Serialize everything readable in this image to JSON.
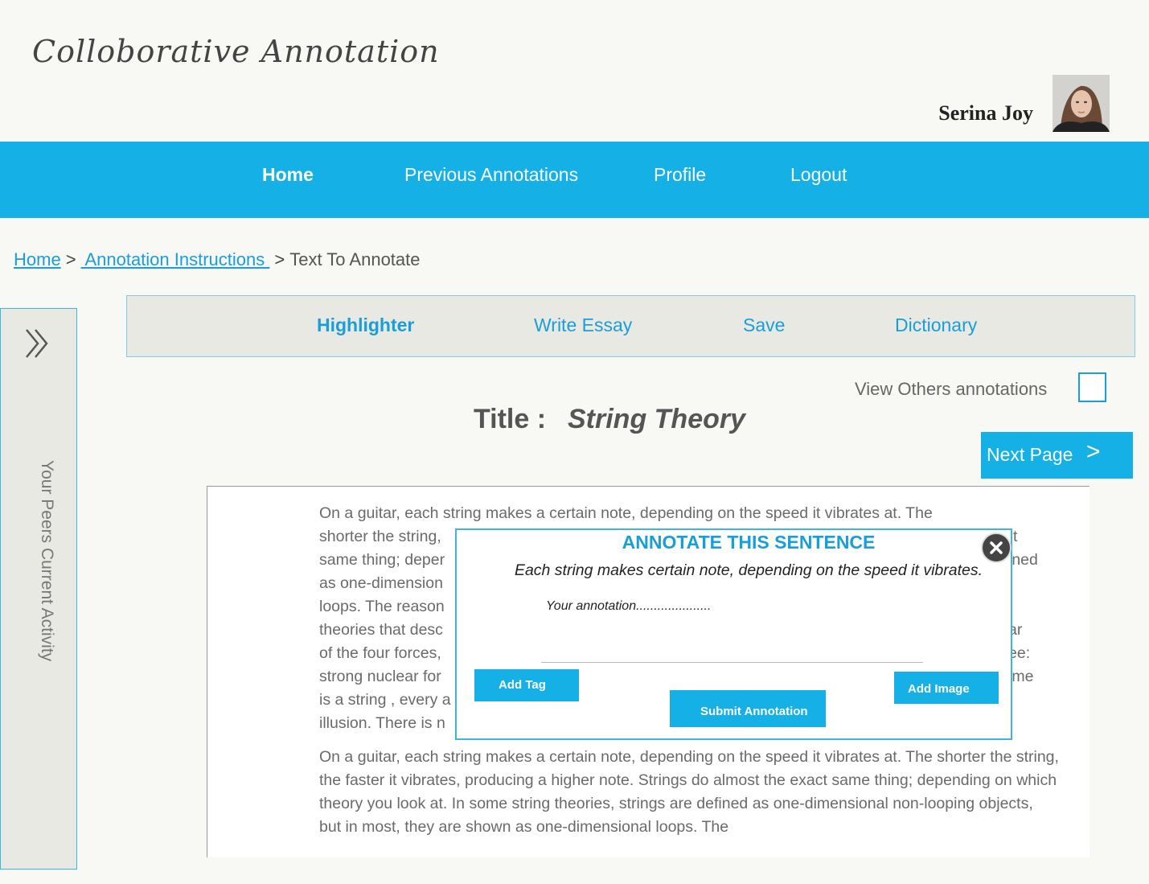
{
  "app": {
    "title": "Colloborative Annotation"
  },
  "user": {
    "name": "Serina Joy"
  },
  "nav": {
    "items": [
      {
        "label": "Home"
      },
      {
        "label": "Previous Annotations"
      },
      {
        "label": "Profile"
      },
      {
        "label": "Logout"
      }
    ],
    "active": "Home"
  },
  "breadcrumb": {
    "items": [
      {
        "label": "Home"
      },
      {
        "label": " Annotation Instructions "
      },
      {
        "label": "Text To Annotate"
      }
    ],
    "separator": ">"
  },
  "side_panel": {
    "label": "Your Peers Current Activity",
    "icon": "double-chevron-right-icon"
  },
  "toolbar": {
    "items": [
      {
        "label": "Highlighter"
      },
      {
        "label": "Write Essay"
      },
      {
        "label": "Save"
      },
      {
        "label": "Dictionary"
      }
    ],
    "active": "Highlighter"
  },
  "view_others": {
    "label": "View Others annotations",
    "checked": false
  },
  "document": {
    "title_label": "Title :",
    "title_value": "String Theory",
    "paragraph1_lines": [
      "On a guitar, each string makes a certain note, depending on the speed it vibrates at. The",
      "shorter the string,",
      "same thing; deper",
      "as one-dimension",
      "loops. The reason",
      "theories that desc",
      "of the four forces,",
      "strong nuclear for",
      "is a string , every a",
      "illusion. There is n"
    ],
    "paragraph1_tails": [
      "t",
      "ined",
      "",
      "",
      "ar",
      "ee:",
      "ime"
    ],
    "paragraph2": "On a guitar, each string makes a certain note, depending on the speed it vibrates at. The shorter the string, the faster it vibrates, producing a higher note. Strings do almost the exact same thing; depending on which theory you look at. In some string theories, strings are defined as one-dimensional non-looping objects, but in most, they are shown as one-dimensional loops. The"
  },
  "next_page": {
    "label": "Next Page",
    "icon": ">"
  },
  "annotation_modal": {
    "title": "ANNOTATE THIS SENTENCE",
    "sentence": "Each string makes certain note, depending on the speed it vibrates.",
    "input_placeholder": "Your annotation.....................",
    "add_tag_label": "Add Tag",
    "add_image_label": "Add Image",
    "submit_label": "Submit Annotation"
  },
  "colors": {
    "accent": "#14b0e6",
    "link": "#1a9ed8",
    "background": "#f8f8f4",
    "panel": "#e9e9e3"
  }
}
